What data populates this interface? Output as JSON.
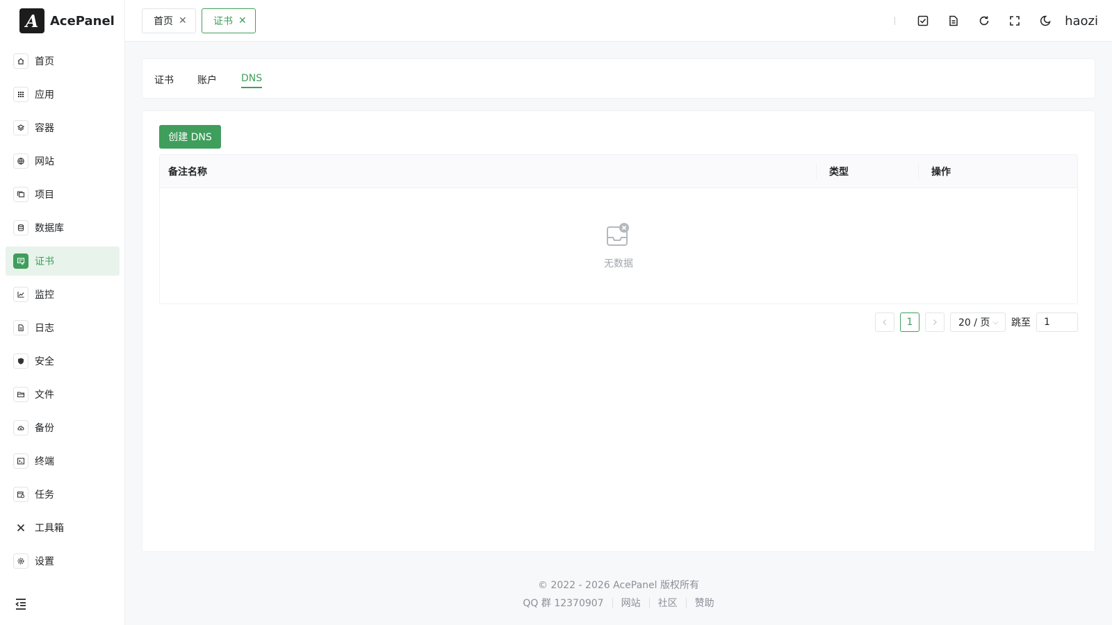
{
  "app": {
    "logo_text": "AcePanel",
    "logo_mark": "A"
  },
  "sidebar": {
    "items": [
      {
        "label": "首页",
        "icon": "home-icon"
      },
      {
        "label": "应用",
        "icon": "apps-grid-icon"
      },
      {
        "label": "容器",
        "icon": "layers-icon"
      },
      {
        "label": "网站",
        "icon": "globe-icon"
      },
      {
        "label": "项目",
        "icon": "folders-icon"
      },
      {
        "label": "数据库",
        "icon": "database-icon"
      },
      {
        "label": "证书",
        "icon": "certificate-icon",
        "active": true
      },
      {
        "label": "监控",
        "icon": "chart-line-icon"
      },
      {
        "label": "日志",
        "icon": "document-icon"
      },
      {
        "label": "安全",
        "icon": "shield-icon"
      },
      {
        "label": "文件",
        "icon": "folder-icon"
      },
      {
        "label": "备份",
        "icon": "cloud-backup-icon"
      },
      {
        "label": "终端",
        "icon": "terminal-icon"
      },
      {
        "label": "任务",
        "icon": "calendar-task-icon"
      },
      {
        "label": "工具箱",
        "icon": "tools-icon"
      },
      {
        "label": "设置",
        "icon": "gear-icon"
      }
    ]
  },
  "topbar": {
    "tabs": [
      {
        "label": "首页",
        "active": false
      },
      {
        "label": "证书",
        "active": true
      }
    ],
    "username": "haozi"
  },
  "subtabs": [
    {
      "label": "证书",
      "active": false
    },
    {
      "label": "账户",
      "active": false
    },
    {
      "label": "DNS",
      "active": true
    }
  ],
  "toolbar": {
    "create_label": "创建 DNS"
  },
  "table": {
    "columns": [
      "备注名称",
      "类型",
      "操作"
    ],
    "rows": [],
    "empty_text": "无数据"
  },
  "pager": {
    "current_page": "1",
    "page_size": "20 / 页",
    "jump_label": "跳至",
    "jump_value": "1"
  },
  "footer": {
    "copyright": "© 2022 - 2026 AcePanel 版权所有",
    "qq": "QQ 群 12370907",
    "links": [
      "网站",
      "社区",
      "赞助"
    ]
  },
  "colors": {
    "accent": "#3f9e5c",
    "accent_bg": "#e8f3ec"
  }
}
